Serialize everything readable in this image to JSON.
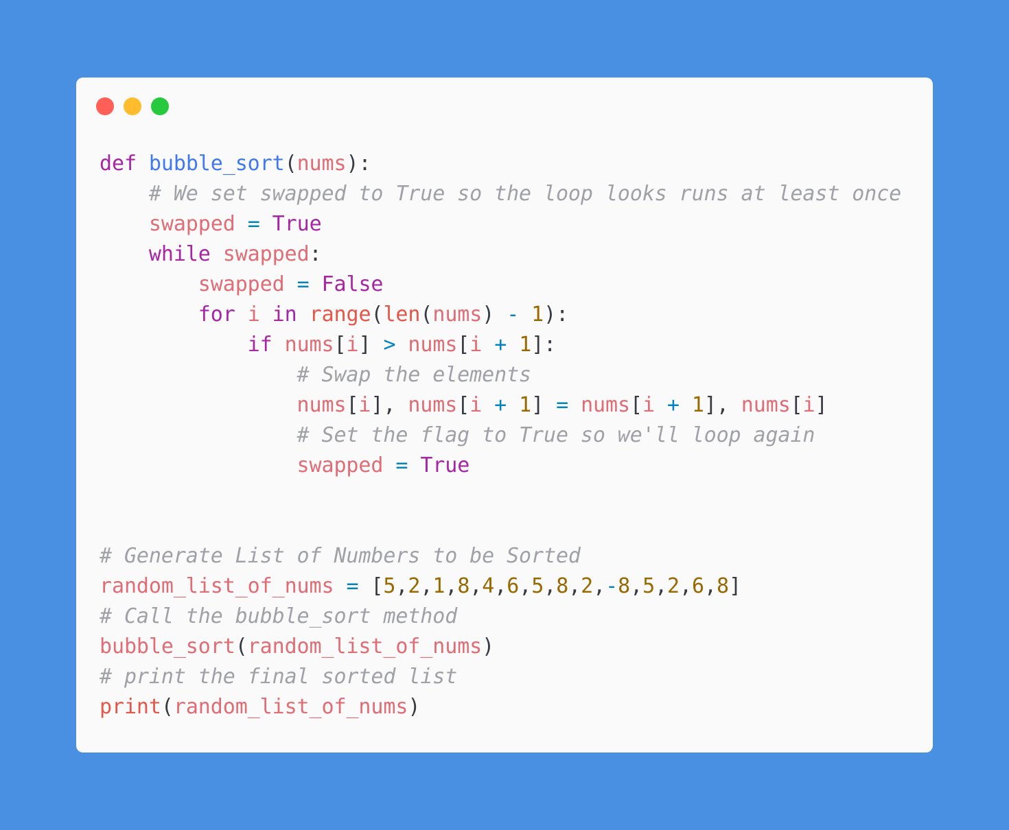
{
  "window": {
    "controls": {
      "close": "#ff5f56",
      "minimize": "#ffbd2e",
      "maximize": "#27c93f"
    },
    "background": "#fafafa",
    "page_background": "#4a90e2"
  },
  "code": {
    "language": "python",
    "lines": [
      [
        {
          "t": "def",
          "k": "keyword"
        },
        {
          "t": " ",
          "k": "plain"
        },
        {
          "t": "bubble_sort",
          "k": "function"
        },
        {
          "t": "(",
          "k": "punct"
        },
        {
          "t": "nums",
          "k": "variable"
        },
        {
          "t": "):",
          "k": "punct"
        }
      ],
      [
        {
          "t": "    ",
          "k": "plain"
        },
        {
          "t": "# We set swapped to True so the loop looks runs at least once",
          "k": "comment"
        }
      ],
      [
        {
          "t": "    ",
          "k": "plain"
        },
        {
          "t": "swapped",
          "k": "variable"
        },
        {
          "t": " ",
          "k": "plain"
        },
        {
          "t": "=",
          "k": "operator"
        },
        {
          "t": " ",
          "k": "plain"
        },
        {
          "t": "True",
          "k": "keyword"
        }
      ],
      [
        {
          "t": "    ",
          "k": "plain"
        },
        {
          "t": "while",
          "k": "keyword"
        },
        {
          "t": " ",
          "k": "plain"
        },
        {
          "t": "swapped",
          "k": "variable"
        },
        {
          "t": ":",
          "k": "punct"
        }
      ],
      [
        {
          "t": "        ",
          "k": "plain"
        },
        {
          "t": "swapped",
          "k": "variable"
        },
        {
          "t": " ",
          "k": "plain"
        },
        {
          "t": "=",
          "k": "operator"
        },
        {
          "t": " ",
          "k": "plain"
        },
        {
          "t": "False",
          "k": "keyword"
        }
      ],
      [
        {
          "t": "        ",
          "k": "plain"
        },
        {
          "t": "for",
          "k": "keyword"
        },
        {
          "t": " ",
          "k": "plain"
        },
        {
          "t": "i",
          "k": "variable"
        },
        {
          "t": " ",
          "k": "plain"
        },
        {
          "t": "in",
          "k": "keyword"
        },
        {
          "t": " ",
          "k": "plain"
        },
        {
          "t": "range",
          "k": "builtin"
        },
        {
          "t": "(",
          "k": "punct"
        },
        {
          "t": "len",
          "k": "builtin"
        },
        {
          "t": "(",
          "k": "punct"
        },
        {
          "t": "nums",
          "k": "variable"
        },
        {
          "t": ")",
          "k": "punct"
        },
        {
          "t": " ",
          "k": "plain"
        },
        {
          "t": "-",
          "k": "operator"
        },
        {
          "t": " ",
          "k": "plain"
        },
        {
          "t": "1",
          "k": "number"
        },
        {
          "t": "):",
          "k": "punct"
        }
      ],
      [
        {
          "t": "            ",
          "k": "plain"
        },
        {
          "t": "if",
          "k": "keyword"
        },
        {
          "t": " ",
          "k": "plain"
        },
        {
          "t": "nums",
          "k": "variable"
        },
        {
          "t": "[",
          "k": "punct"
        },
        {
          "t": "i",
          "k": "variable"
        },
        {
          "t": "]",
          "k": "punct"
        },
        {
          "t": " ",
          "k": "plain"
        },
        {
          "t": ">",
          "k": "operator"
        },
        {
          "t": " ",
          "k": "plain"
        },
        {
          "t": "nums",
          "k": "variable"
        },
        {
          "t": "[",
          "k": "punct"
        },
        {
          "t": "i",
          "k": "variable"
        },
        {
          "t": " ",
          "k": "plain"
        },
        {
          "t": "+",
          "k": "operator"
        },
        {
          "t": " ",
          "k": "plain"
        },
        {
          "t": "1",
          "k": "number"
        },
        {
          "t": "]:",
          "k": "punct"
        }
      ],
      [
        {
          "t": "                ",
          "k": "plain"
        },
        {
          "t": "# Swap the elements",
          "k": "comment"
        }
      ],
      [
        {
          "t": "                ",
          "k": "plain"
        },
        {
          "t": "nums",
          "k": "variable"
        },
        {
          "t": "[",
          "k": "punct"
        },
        {
          "t": "i",
          "k": "variable"
        },
        {
          "t": "], ",
          "k": "punct"
        },
        {
          "t": "nums",
          "k": "variable"
        },
        {
          "t": "[",
          "k": "punct"
        },
        {
          "t": "i",
          "k": "variable"
        },
        {
          "t": " ",
          "k": "plain"
        },
        {
          "t": "+",
          "k": "operator"
        },
        {
          "t": " ",
          "k": "plain"
        },
        {
          "t": "1",
          "k": "number"
        },
        {
          "t": "]",
          "k": "punct"
        },
        {
          "t": " ",
          "k": "plain"
        },
        {
          "t": "=",
          "k": "operator"
        },
        {
          "t": " ",
          "k": "plain"
        },
        {
          "t": "nums",
          "k": "variable"
        },
        {
          "t": "[",
          "k": "punct"
        },
        {
          "t": "i",
          "k": "variable"
        },
        {
          "t": " ",
          "k": "plain"
        },
        {
          "t": "+",
          "k": "operator"
        },
        {
          "t": " ",
          "k": "plain"
        },
        {
          "t": "1",
          "k": "number"
        },
        {
          "t": "], ",
          "k": "punct"
        },
        {
          "t": "nums",
          "k": "variable"
        },
        {
          "t": "[",
          "k": "punct"
        },
        {
          "t": "i",
          "k": "variable"
        },
        {
          "t": "]",
          "k": "punct"
        }
      ],
      [
        {
          "t": "                ",
          "k": "plain"
        },
        {
          "t": "# Set the flag to True so we'll loop again",
          "k": "comment"
        }
      ],
      [
        {
          "t": "                ",
          "k": "plain"
        },
        {
          "t": "swapped",
          "k": "variable"
        },
        {
          "t": " ",
          "k": "plain"
        },
        {
          "t": "=",
          "k": "operator"
        },
        {
          "t": " ",
          "k": "plain"
        },
        {
          "t": "True",
          "k": "keyword"
        }
      ],
      [],
      [],
      [
        {
          "t": "# Generate List of Numbers to be Sorted",
          "k": "comment"
        }
      ],
      [
        {
          "t": "random_list_of_nums",
          "k": "variable"
        },
        {
          "t": " ",
          "k": "plain"
        },
        {
          "t": "=",
          "k": "operator"
        },
        {
          "t": " ",
          "k": "plain"
        },
        {
          "t": "[",
          "k": "punct"
        },
        {
          "t": "5",
          "k": "number"
        },
        {
          "t": ",",
          "k": "punct"
        },
        {
          "t": "2",
          "k": "number"
        },
        {
          "t": ",",
          "k": "punct"
        },
        {
          "t": "1",
          "k": "number"
        },
        {
          "t": ",",
          "k": "punct"
        },
        {
          "t": "8",
          "k": "number"
        },
        {
          "t": ",",
          "k": "punct"
        },
        {
          "t": "4",
          "k": "number"
        },
        {
          "t": ",",
          "k": "punct"
        },
        {
          "t": "6",
          "k": "number"
        },
        {
          "t": ",",
          "k": "punct"
        },
        {
          "t": "5",
          "k": "number"
        },
        {
          "t": ",",
          "k": "punct"
        },
        {
          "t": "8",
          "k": "number"
        },
        {
          "t": ",",
          "k": "punct"
        },
        {
          "t": "2",
          "k": "number"
        },
        {
          "t": ",",
          "k": "punct"
        },
        {
          "t": "-",
          "k": "operator"
        },
        {
          "t": "8",
          "k": "number"
        },
        {
          "t": ",",
          "k": "punct"
        },
        {
          "t": "5",
          "k": "number"
        },
        {
          "t": ",",
          "k": "punct"
        },
        {
          "t": "2",
          "k": "number"
        },
        {
          "t": ",",
          "k": "punct"
        },
        {
          "t": "6",
          "k": "number"
        },
        {
          "t": ",",
          "k": "punct"
        },
        {
          "t": "8",
          "k": "number"
        },
        {
          "t": "]",
          "k": "punct"
        }
      ],
      [
        {
          "t": "# Call the bubble_sort method",
          "k": "comment"
        }
      ],
      [
        {
          "t": "bubble_sort",
          "k": "variable"
        },
        {
          "t": "(",
          "k": "punct"
        },
        {
          "t": "random_list_of_nums",
          "k": "variable"
        },
        {
          "t": ")",
          "k": "punct"
        }
      ],
      [
        {
          "t": "# print the final sorted list",
          "k": "comment"
        }
      ],
      [
        {
          "t": "print",
          "k": "builtin"
        },
        {
          "t": "(",
          "k": "punct"
        },
        {
          "t": "random_list_of_nums",
          "k": "variable"
        },
        {
          "t": ")",
          "k": "punct"
        }
      ]
    ]
  }
}
